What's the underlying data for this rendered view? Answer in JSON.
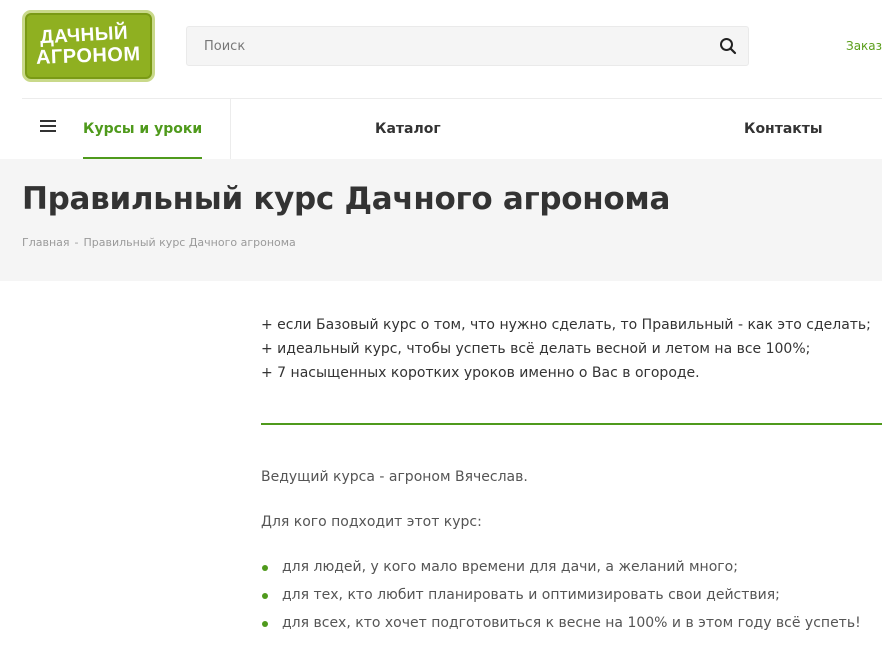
{
  "logo": {
    "line1": "ДАЧНЫЙ",
    "line2": "АГРОНОМ"
  },
  "search": {
    "placeholder": "Поиск"
  },
  "header_link": "Заказ",
  "nav": {
    "items": [
      {
        "label": "Курсы и уроки",
        "active": true
      },
      {
        "label": "Каталог"
      },
      {
        "label": "Контакты"
      }
    ]
  },
  "page": {
    "title": "Правильный курс Дачного агронома",
    "breadcrumb": {
      "home": "Главная",
      "separator": "-",
      "current": "Правильный курс Дачного агронома"
    }
  },
  "content": {
    "intro": [
      "+ если Базовый курс о том, что нужно сделать, то Правильный - как это сделать;",
      "+ идеальный курс, чтобы успеть всё делать весной и летом на все 100%;",
      "+ 7 насыщенных коротких уроков именно о Вас в огороде."
    ],
    "host": "Ведущий курса - агроном Вячеслав.",
    "audience_heading": "Для кого подходит этот курс:",
    "audience": [
      "для людей, у кого мало времени для дачи, а желаний много;",
      "для тех, кто любит планировать и оптимизировать свои действия;",
      "для всех, кто хочет подготовиться к весне на 100% и в этом году всё успеть!"
    ]
  },
  "colors": {
    "accent": "#4f9a1c",
    "logo_bg": "#8fb021",
    "band_bg": "#f5f5f5"
  }
}
